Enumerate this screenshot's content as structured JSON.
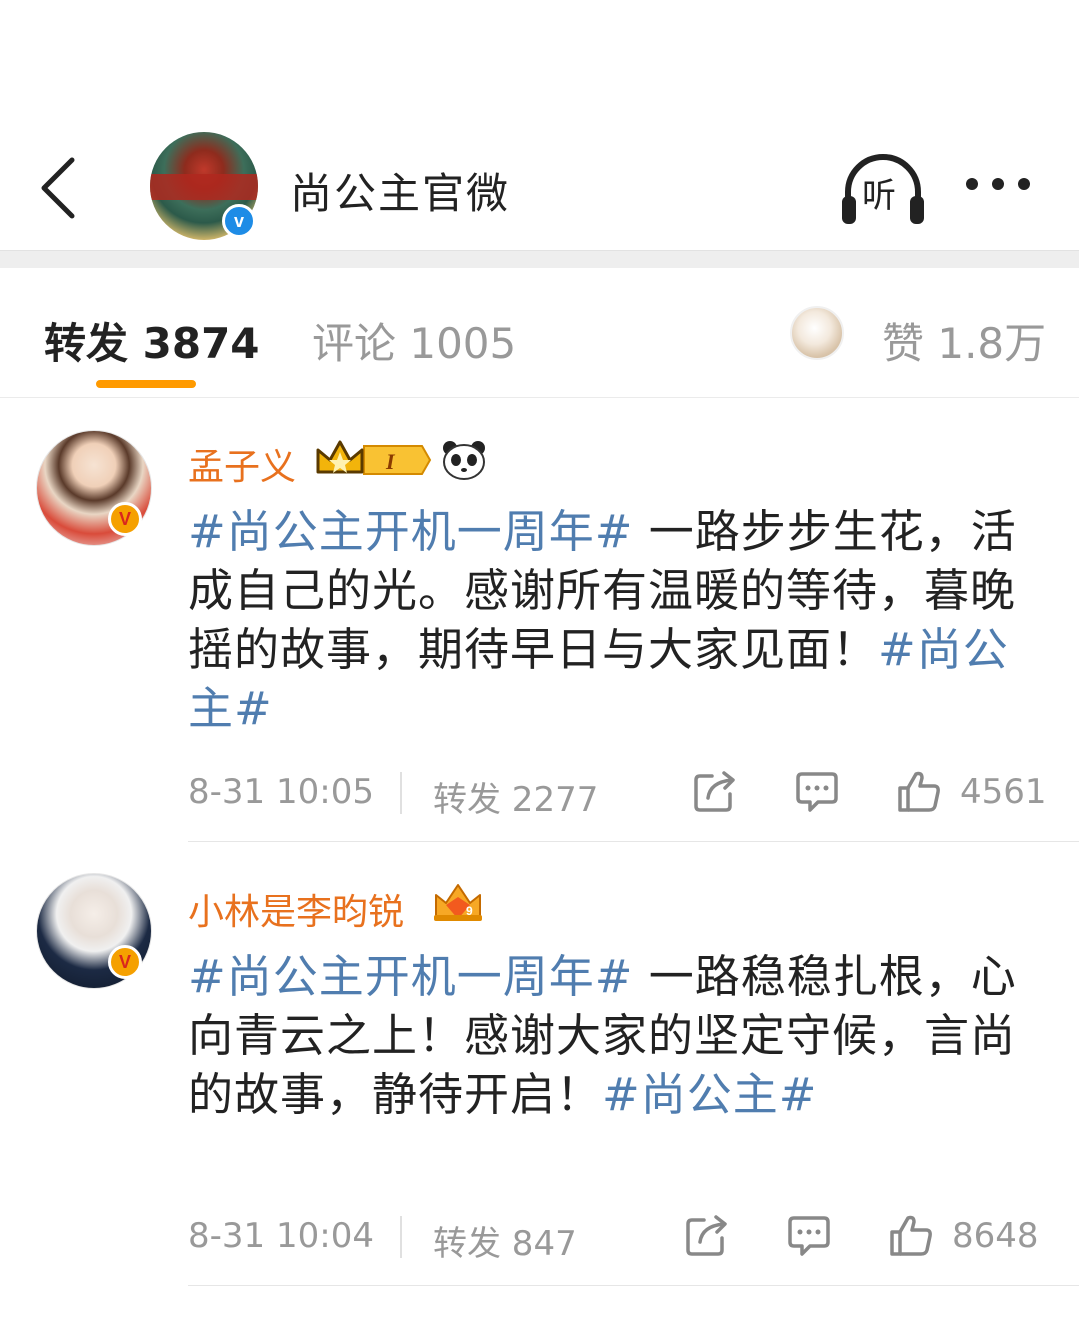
{
  "header": {
    "title": "尚公主官微",
    "listen_label": "听"
  },
  "tabs": {
    "repost": "转发 3874",
    "comment": "评论 1005",
    "like": "赞 1.8万"
  },
  "posts": [
    {
      "username": "孟子义",
      "verified_badge": "V",
      "text_parts": [
        {
          "type": "tag",
          "text": "#尚公主开机一周年#"
        },
        {
          "type": "text",
          "text": " 一路步步生花，活成自己的光。感谢所有温暖的等待，暮晚摇的故事，期待早日与大家见面！"
        },
        {
          "type": "tag",
          "text": "#尚公主#"
        }
      ],
      "time": "8-31 10:05",
      "repost": "转发 2277",
      "likes": "4561",
      "badges": [
        "crown-level-badge",
        "panda-icon"
      ]
    },
    {
      "username": "小林是李昀锐",
      "verified_badge": "V",
      "text_parts": [
        {
          "type": "tag",
          "text": "#尚公主开机一周年#"
        },
        {
          "type": "text",
          "text": " 一路稳稳扎根，心向青云之上！感谢大家的坚定守候，言尚的故事，静待开启！"
        },
        {
          "type": "tag",
          "text": "#尚公主#"
        }
      ],
      "time": "8-31 10:04",
      "repost": "转发 847",
      "likes": "8648",
      "badges": [
        "crown-fan-badge"
      ]
    }
  ],
  "colors": {
    "accent": "#ff9a00",
    "username": "#e8711e",
    "hashtag": "#507daf",
    "muted": "#999999",
    "verified_blue": "#1e8ce6",
    "verified_orange": "#f5a000"
  }
}
